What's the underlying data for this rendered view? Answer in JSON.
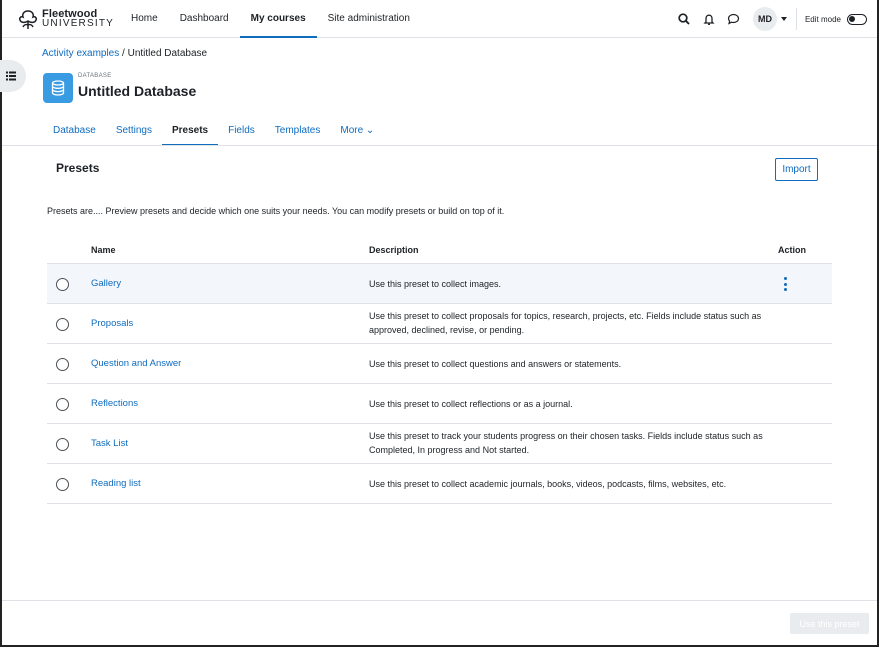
{
  "brand": {
    "line1": "Fleetwood",
    "line2": "UNIVERSITY"
  },
  "nav": {
    "items": [
      {
        "label": "Home",
        "active": false
      },
      {
        "label": "Dashboard",
        "active": false
      },
      {
        "label": "My courses",
        "active": true
      },
      {
        "label": "Site administration",
        "active": false
      }
    ],
    "avatar_initials": "MD",
    "edit_mode_label": "Edit mode"
  },
  "breadcrumb": {
    "parent": "Activity examples",
    "separator": " / ",
    "current": "Untitled Database"
  },
  "activity": {
    "kicker": "DATABASE",
    "title": "Untitled Database"
  },
  "subnav": {
    "items": [
      {
        "label": "Database",
        "active": false
      },
      {
        "label": "Settings",
        "active": false
      },
      {
        "label": "Presets",
        "active": true
      },
      {
        "label": "Fields",
        "active": false
      },
      {
        "label": "Templates",
        "active": false
      },
      {
        "label": "More ⌄",
        "active": false
      }
    ]
  },
  "presets": {
    "title": "Presets",
    "import_label": "Import",
    "intro": "Presets are.... Preview presets and decide which one suits your needs. You can modify presets or build on top of it.",
    "columns": {
      "name": "Name",
      "description": "Description",
      "action": "Action"
    },
    "rows": [
      {
        "name": "Gallery",
        "description": "Use this preset to collect images."
      },
      {
        "name": "Proposals",
        "description": "Use this preset to collect proposals for topics, research, projects, etc. Fields include status such as approved, declined, revise, or pending."
      },
      {
        "name": "Question and Answer",
        "description": "Use this preset to collect questions and answers or statements."
      },
      {
        "name": "Reflections",
        "description": "Use this preset to collect reflections or as a journal."
      },
      {
        "name": "Task List",
        "description": "Use this preset to track your students progress on their chosen tasks. Fields include status such as Completed, In progress and Not started."
      },
      {
        "name": "Reading list",
        "description": "Use this preset to collect academic journals, books, videos, podcasts, films, websites, etc."
      }
    ]
  },
  "footer": {
    "use_preset_label": "Use this preset"
  },
  "colors": {
    "accent": "#0f6cbf",
    "db_icon_bg": "#399be2",
    "row_highlight": "#f3f6fa"
  },
  "icons": [
    "flower-logo-icon",
    "search-icon",
    "bell-icon",
    "chat-icon",
    "drawer-list-icon",
    "database-icon",
    "kebab-menu-icon"
  ]
}
